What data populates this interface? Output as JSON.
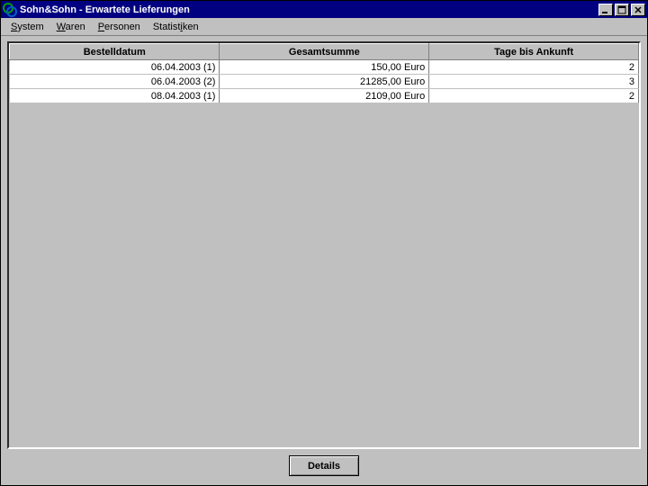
{
  "window": {
    "title": "Sohn&Sohn - Erwartete Lieferungen"
  },
  "menubar": {
    "items": [
      {
        "label": "System",
        "mn_index": 0
      },
      {
        "label": "Waren",
        "mn_index": 0
      },
      {
        "label": "Personen",
        "mn_index": 0
      },
      {
        "label": "Statistiken",
        "mn_index": 7
      }
    ]
  },
  "table": {
    "columns": [
      "Bestelldatum",
      "Gesamtsumme",
      "Tage bis Ankunft"
    ],
    "rows": [
      {
        "date": "06.04.2003 (1)",
        "sum": "150,00 Euro",
        "days": "2"
      },
      {
        "date": "06.04.2003 (2)",
        "sum": "21285,00 Euro",
        "days": "3"
      },
      {
        "date": "08.04.2003 (1)",
        "sum": "2109,00 Euro",
        "days": "2"
      }
    ]
  },
  "buttons": {
    "details": "Details"
  }
}
